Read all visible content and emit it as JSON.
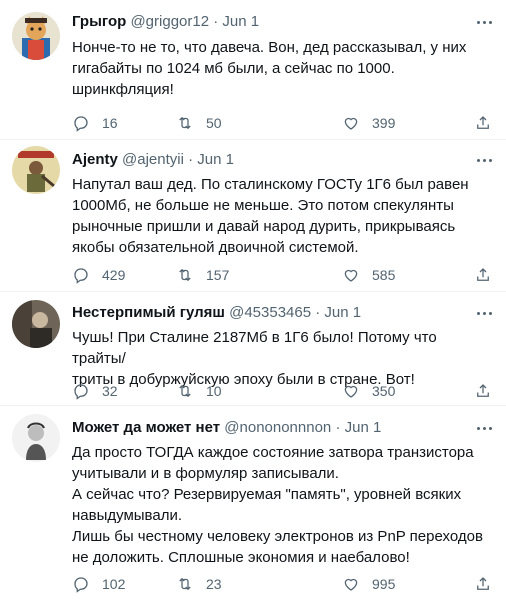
{
  "tweets": [
    {
      "name": "Грыгор",
      "handle": "@griggor12",
      "dot": "·",
      "date": "Jun 1",
      "text": "Нонче-то не то, что давеча. Вон, дед рассказывал, у них\nгигабайты по 1024 мб были, а сейчас по 1000.\nшринкфляция!",
      "replies": "16",
      "retweets": "50",
      "likes": "399",
      "avatar": "cat-cossack-avatar"
    },
    {
      "name": "Ajenty",
      "handle": "@ajentyii",
      "dot": "·",
      "date": "Jun 1",
      "text": "Напутал ваш дед. По сталинскому ГОСТу 1Г6 был равен\n1000Мб, не больше не меньше. Это потом спекулянты\nрыночные пришли и давай народ дурить, прикрываясь\nякобы обязательной двоичной системой.",
      "replies": "429",
      "retweets": "157",
      "likes": "585",
      "avatar": "soviet-poster-avatar"
    },
    {
      "name": "Нестерпимый гуляш",
      "handle": "@45353465",
      "dot": "·",
      "date": "Jun 1",
      "text": "Чушь! При Сталине 2187Мб в 1Г6 было! Потому что трайты/\nтриты в добуржуйскую эпоху были в стране. Вот!",
      "replies": "32",
      "retweets": "10",
      "likes": "350",
      "avatar": "photo-avatar"
    },
    {
      "name": "Может да может нет",
      "handle": "@nonononnnon",
      "dot": "·",
      "date": "Jun 1",
      "text": "Да просто ТОГДА каждое состояние затвора транзистора\nучитывали и в формуляр записывали.\nА сейчас что? Резервируемая \"память\", уровней всяких\nнавыдумывали.\nЛишь бы честному человеку электронов из PnP переходов\nне доложить. Сплошные экономия и наебалово!",
      "replies": "102",
      "retweets": "23",
      "likes": "995",
      "avatar": "sketch-portrait-avatar"
    }
  ],
  "colors": {
    "text": "#0f1419",
    "secondary": "#536471",
    "divider": "#eff3f4"
  },
  "icons": [
    "reply-icon",
    "retweet-icon",
    "like-icon",
    "share-icon",
    "more-icon"
  ]
}
